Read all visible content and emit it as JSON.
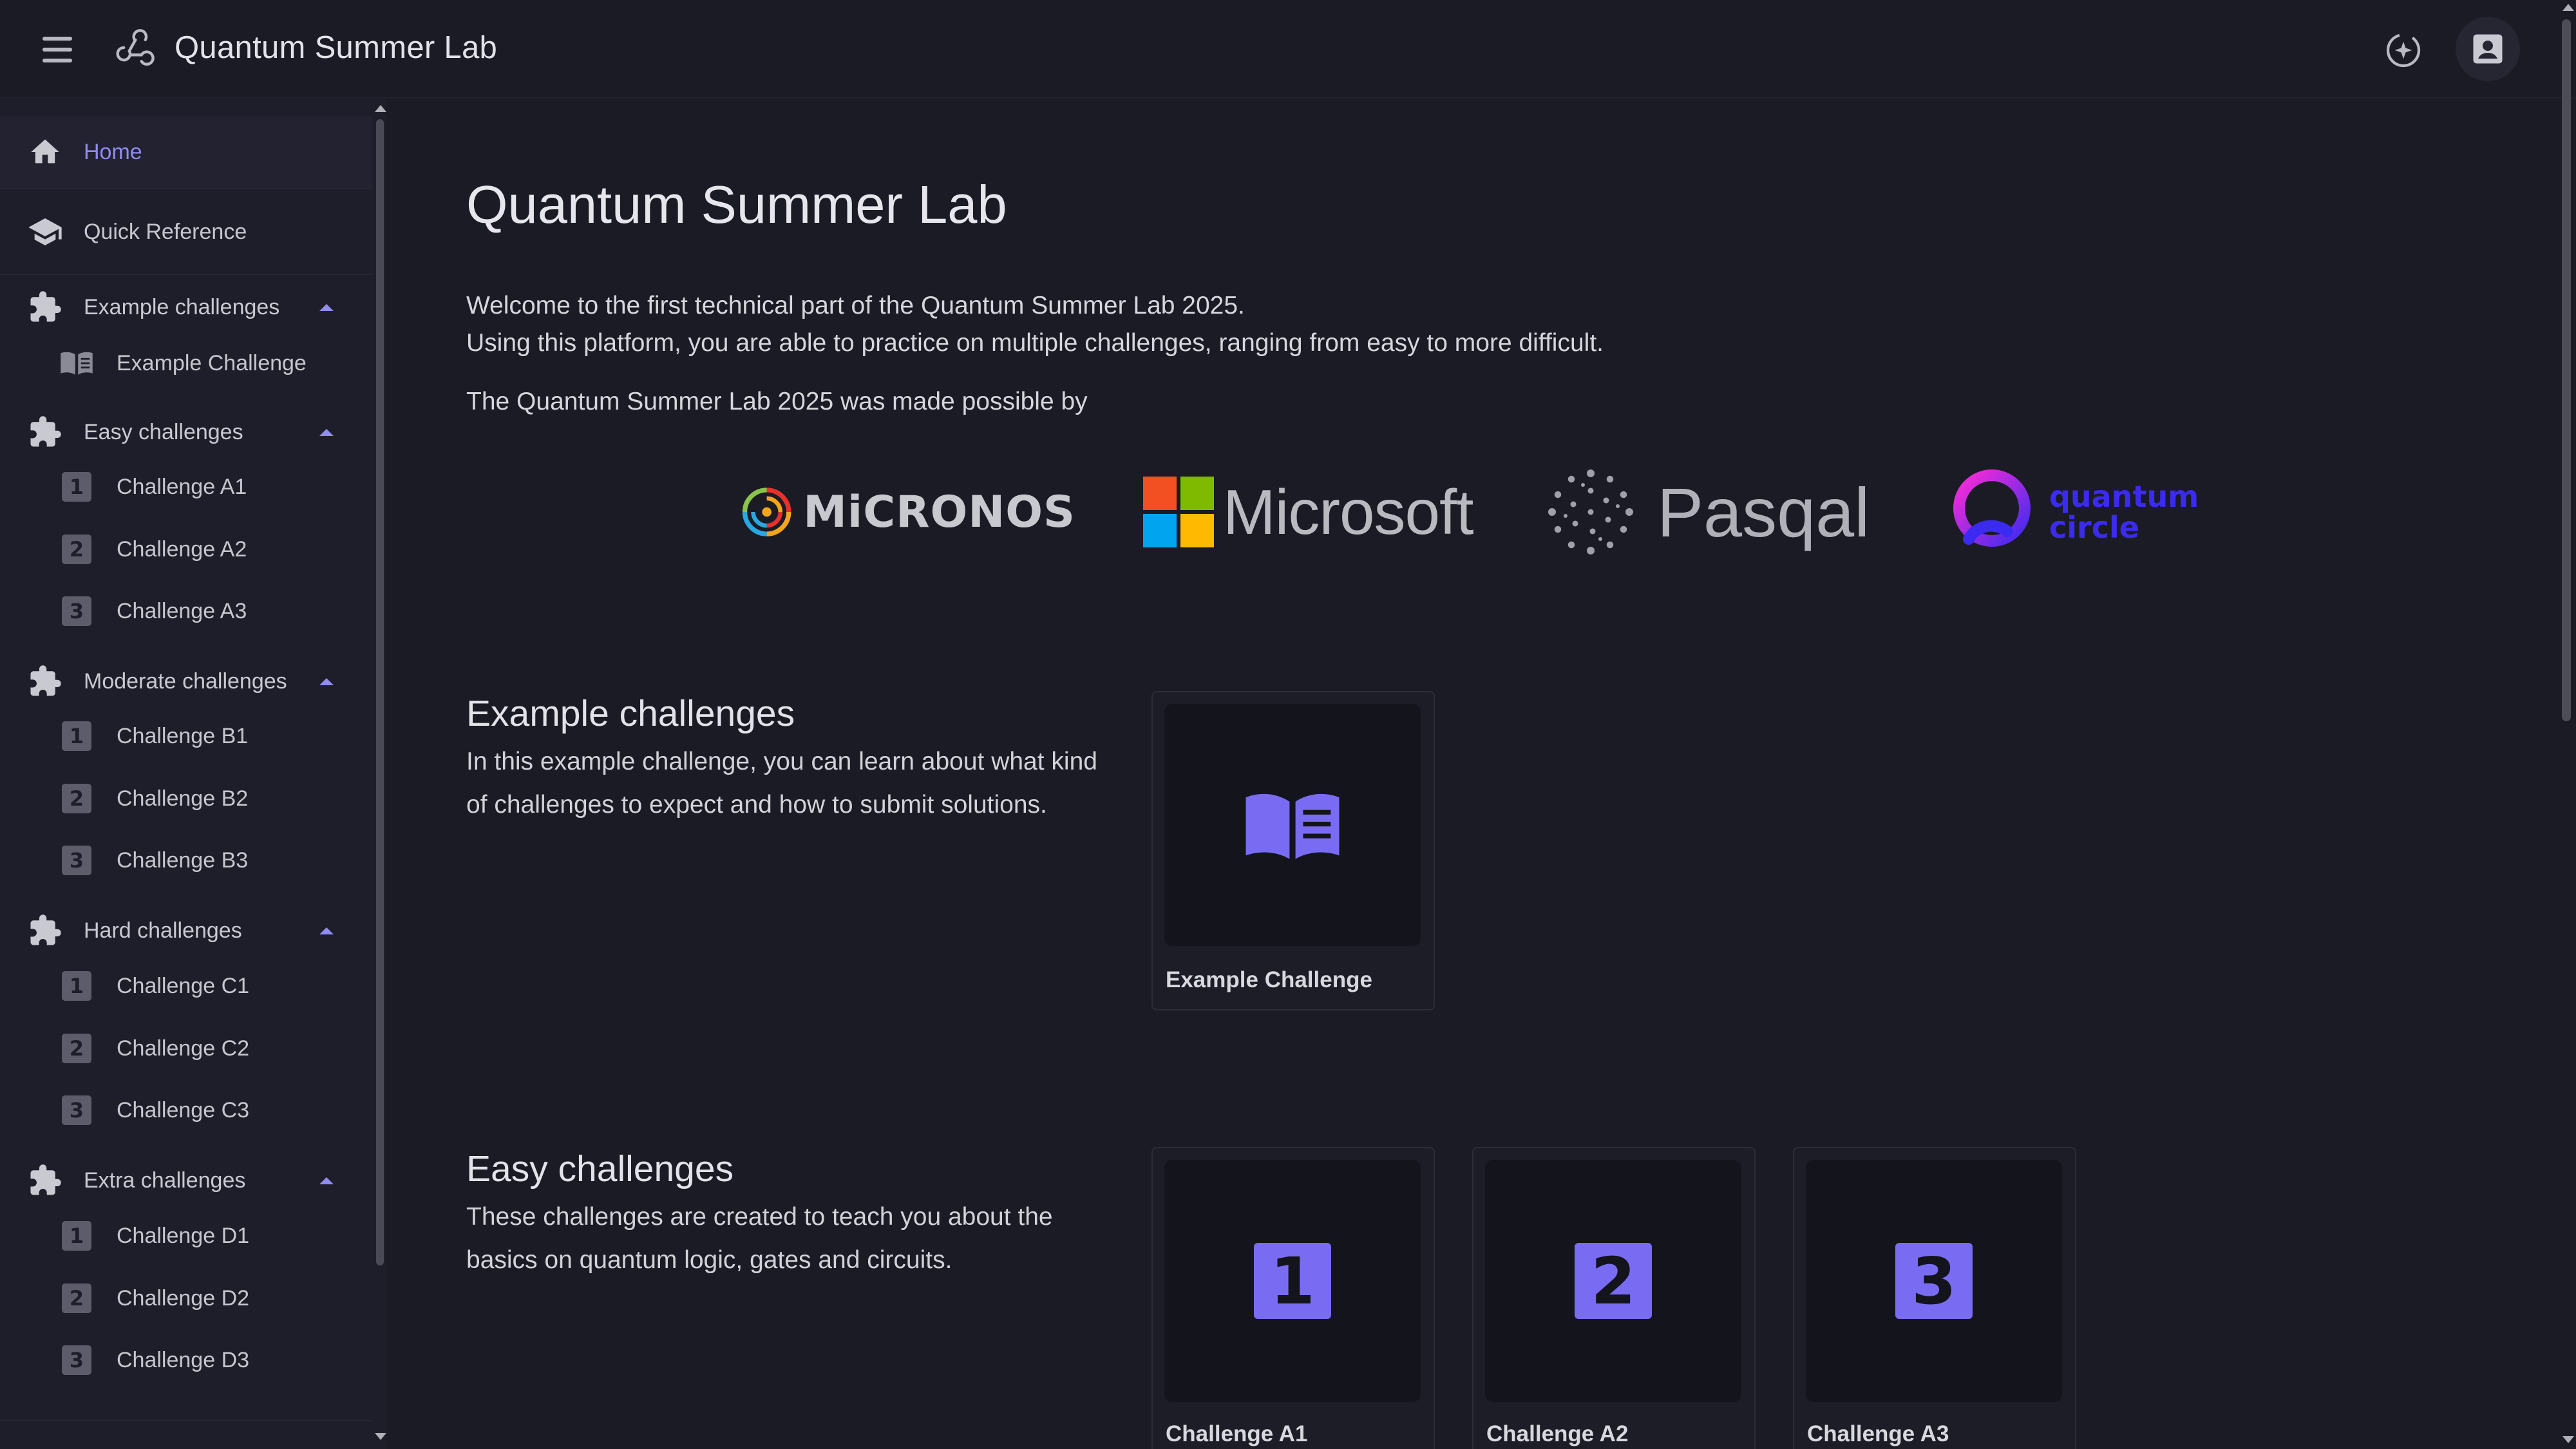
{
  "app": {
    "title": "Quantum Summer Lab",
    "menu_icon": "hamburger-menu-icon",
    "logo_icon": "webhook-logo-icon",
    "theme_icon": "theme-toggle-icon",
    "account_icon": "account-box-icon"
  },
  "sidebar": {
    "home": "Home",
    "quick_reference": "Quick Reference",
    "groups": [
      {
        "label": "Example challenges",
        "items": [
          {
            "label": "Example Challenge",
            "icon": "book-open-icon"
          }
        ]
      },
      {
        "label": "Easy challenges",
        "items": [
          {
            "label": "Challenge A1",
            "num": "1"
          },
          {
            "label": "Challenge A2",
            "num": "2"
          },
          {
            "label": "Challenge A3",
            "num": "3"
          }
        ]
      },
      {
        "label": "Moderate challenges",
        "items": [
          {
            "label": "Challenge B1",
            "num": "1"
          },
          {
            "label": "Challenge B2",
            "num": "2"
          },
          {
            "label": "Challenge B3",
            "num": "3"
          }
        ]
      },
      {
        "label": "Hard challenges",
        "items": [
          {
            "label": "Challenge C1",
            "num": "1"
          },
          {
            "label": "Challenge C2",
            "num": "2"
          },
          {
            "label": "Challenge C3",
            "num": "3"
          }
        ]
      },
      {
        "label": "Extra challenges",
        "items": [
          {
            "label": "Challenge D1",
            "num": "1"
          },
          {
            "label": "Challenge D2",
            "num": "2"
          },
          {
            "label": "Challenge D3",
            "num": "3"
          }
        ]
      }
    ]
  },
  "main": {
    "title": "Quantum Summer Lab",
    "intro_line1": "Welcome to the first technical part of the Quantum Summer Lab 2025.",
    "intro_line2": "Using this platform, you are able to practice on multiple challenges, ranging from easy to more difficult.",
    "sponsor_line": "The Quantum Summer Lab 2025 was made possible by",
    "sponsors": [
      {
        "name": "MiCRONOS"
      },
      {
        "name": "Microsoft"
      },
      {
        "name": "Pasqal"
      },
      {
        "name_line1": "quantum",
        "name_line2": "circle"
      }
    ],
    "sections": [
      {
        "title": "Example challenges",
        "desc": "In this example challenge, you can learn about what kind of challenges to expect and how to submit solutions.",
        "cards": [
          {
            "label": "Example Challenge",
            "icon": "book-open-icon"
          }
        ]
      },
      {
        "title": "Easy challenges",
        "desc": "These challenges are created to teach you about the basics on quantum logic, gates and circuits.",
        "cards": [
          {
            "label": "Challenge A1",
            "num": "1"
          },
          {
            "label": "Challenge A2",
            "num": "2"
          },
          {
            "label": "Challenge A3",
            "num": "3"
          }
        ]
      }
    ]
  },
  "colors": {
    "background": "#1b1b26",
    "sidebar": "#1e1e2a",
    "accent": "#7a6cf2",
    "active_text": "#8f8cf2"
  }
}
